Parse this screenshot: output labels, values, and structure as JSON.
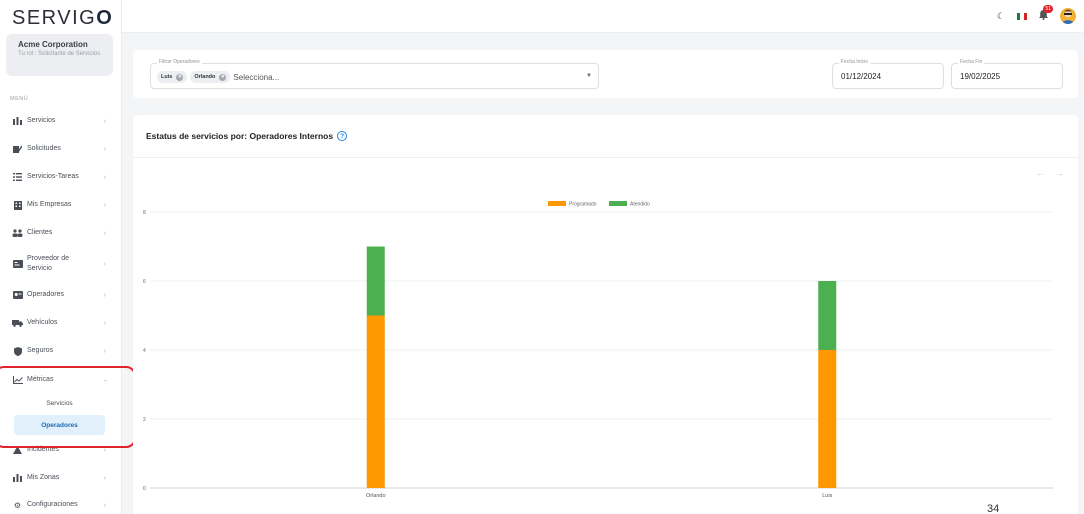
{
  "brand": {
    "logo_text": "SERVIG",
    "logo_mark": "O"
  },
  "company": {
    "name": "Acme Corporation",
    "role": "Tu rol : Solicitante de Servicios"
  },
  "sidebar": {
    "menu_label": "MENÚ",
    "items": [
      {
        "label": "Servicios",
        "icon": "services-icon"
      },
      {
        "label": "Solicitudes",
        "icon": "requests-icon"
      },
      {
        "label": "Servicios-Tareas",
        "icon": "tasks-icon"
      },
      {
        "label": "Mis Empresas",
        "icon": "companies-icon"
      },
      {
        "label": "Clientes",
        "icon": "clients-icon"
      },
      {
        "label": "Proveedor de Servicio",
        "icon": "provider-icon"
      },
      {
        "label": "Operadores",
        "icon": "operators-icon"
      },
      {
        "label": "Vehículos",
        "icon": "vehicles-icon"
      },
      {
        "label": "Seguros",
        "icon": "insurance-icon"
      },
      {
        "label": "Métricas",
        "icon": "metrics-icon"
      },
      {
        "label": "Incidentes",
        "icon": "incidents-icon"
      },
      {
        "label": "Mis Zonas",
        "icon": "zones-icon"
      },
      {
        "label": "Configuraciones",
        "icon": "settings-icon"
      }
    ],
    "metrics_sub": [
      {
        "label": "Servicios"
      },
      {
        "label": "Operadores"
      }
    ]
  },
  "topbar": {
    "notification_count": "51",
    "colors": {
      "badge": "#e0242b"
    }
  },
  "filters": {
    "operators_label": "Filtrar Operadores",
    "chips": [
      "Luis",
      "Orlando"
    ],
    "placeholder": "Selecciona...",
    "start_label": "Fecha Inicio",
    "start_value": "01/12/2024",
    "end_label": "Fecha Fin",
    "end_value": "19/02/2025"
  },
  "chart_title": "Estatus de servicios por: Operadores Internos",
  "chart_data": {
    "type": "bar",
    "stacked": true,
    "categories": [
      "Orlando",
      "Luis"
    ],
    "series": [
      {
        "name": "Programado",
        "values": [
          5,
          4
        ],
        "color": "#ff9800"
      },
      {
        "name": "Atendido",
        "values": [
          2,
          2
        ],
        "color": "#4caf50"
      }
    ],
    "ylim": [
      0,
      8
    ],
    "yticks": [
      0,
      2,
      4,
      6,
      8
    ],
    "legend": "top-center",
    "grid": true
  },
  "page_number": "34"
}
